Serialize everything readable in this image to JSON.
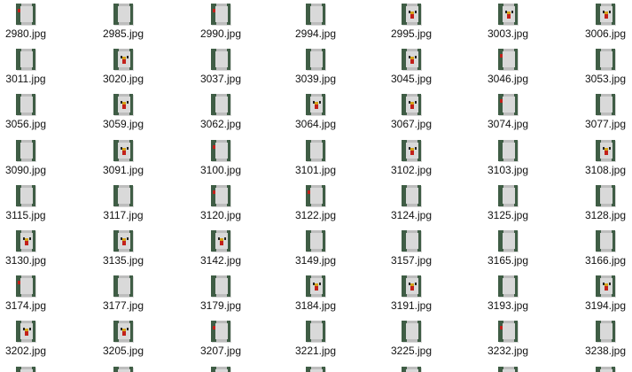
{
  "window": {
    "view": "large icons",
    "background_color": "#ffffff"
  },
  "files": [
    {
      "name": "2980.jpg",
      "variant": "side-red"
    },
    {
      "name": "2985.jpg",
      "variant": "back"
    },
    {
      "name": "2990.jpg",
      "variant": "side-red"
    },
    {
      "name": "2994.jpg",
      "variant": "back"
    },
    {
      "name": "2995.jpg",
      "variant": "front"
    },
    {
      "name": "3003.jpg",
      "variant": "front"
    },
    {
      "name": "3006.jpg",
      "variant": "front"
    },
    {
      "name": "3011.jpg",
      "variant": "back"
    },
    {
      "name": "3020.jpg",
      "variant": "front"
    },
    {
      "name": "3037.jpg",
      "variant": "back"
    },
    {
      "name": "3039.jpg",
      "variant": "back"
    },
    {
      "name": "3045.jpg",
      "variant": "front"
    },
    {
      "name": "3046.jpg",
      "variant": "side-red"
    },
    {
      "name": "3053.jpg",
      "variant": "back"
    },
    {
      "name": "3056.jpg",
      "variant": "back"
    },
    {
      "name": "3059.jpg",
      "variant": "front"
    },
    {
      "name": "3062.jpg",
      "variant": "back"
    },
    {
      "name": "3064.jpg",
      "variant": "front"
    },
    {
      "name": "3067.jpg",
      "variant": "front"
    },
    {
      "name": "3074.jpg",
      "variant": "side-red"
    },
    {
      "name": "3077.jpg",
      "variant": "back"
    },
    {
      "name": "3090.jpg",
      "variant": "back"
    },
    {
      "name": "3091.jpg",
      "variant": "front"
    },
    {
      "name": "3100.jpg",
      "variant": "side-red"
    },
    {
      "name": "3101.jpg",
      "variant": "back"
    },
    {
      "name": "3102.jpg",
      "variant": "front"
    },
    {
      "name": "3103.jpg",
      "variant": "back"
    },
    {
      "name": "3108.jpg",
      "variant": "front"
    },
    {
      "name": "3115.jpg",
      "variant": "back"
    },
    {
      "name": "3117.jpg",
      "variant": "back"
    },
    {
      "name": "3120.jpg",
      "variant": "side-red"
    },
    {
      "name": "3122.jpg",
      "variant": "side-red"
    },
    {
      "name": "3124.jpg",
      "variant": "back"
    },
    {
      "name": "3125.jpg",
      "variant": "back"
    },
    {
      "name": "3128.jpg",
      "variant": "back"
    },
    {
      "name": "3130.jpg",
      "variant": "front"
    },
    {
      "name": "3135.jpg",
      "variant": "front"
    },
    {
      "name": "3142.jpg",
      "variant": "front"
    },
    {
      "name": "3149.jpg",
      "variant": "back"
    },
    {
      "name": "3157.jpg",
      "variant": "back"
    },
    {
      "name": "3165.jpg",
      "variant": "back"
    },
    {
      "name": "3166.jpg",
      "variant": "back"
    },
    {
      "name": "3174.jpg",
      "variant": "side-red"
    },
    {
      "name": "3177.jpg",
      "variant": "back"
    },
    {
      "name": "3179.jpg",
      "variant": "back"
    },
    {
      "name": "3184.jpg",
      "variant": "front"
    },
    {
      "name": "3191.jpg",
      "variant": "front"
    },
    {
      "name": "3193.jpg",
      "variant": "back"
    },
    {
      "name": "3194.jpg",
      "variant": "front"
    },
    {
      "name": "3202.jpg",
      "variant": "front"
    },
    {
      "name": "3205.jpg",
      "variant": "front"
    },
    {
      "name": "3207.jpg",
      "variant": "side-red"
    },
    {
      "name": "3221.jpg",
      "variant": "back"
    },
    {
      "name": "3225.jpg",
      "variant": "back"
    },
    {
      "name": "3232.jpg",
      "variant": "side-red"
    },
    {
      "name": "3238.jpg",
      "variant": "back"
    }
  ],
  "partial_row": {
    "visible_thumbnails": 7
  },
  "colors": {
    "grass_background": "#3f5d45",
    "chicken_body": "#d9d9d9",
    "wattle_red": "#c2201a",
    "beak_yellow": "#d4a017"
  }
}
